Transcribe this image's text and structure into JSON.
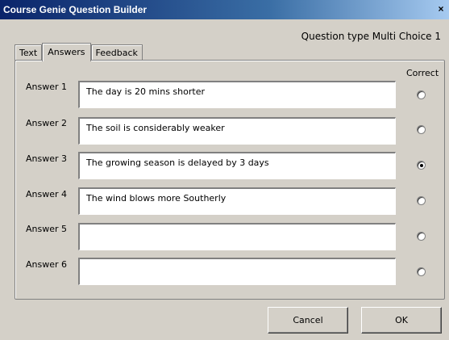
{
  "window": {
    "title": "Course Genie Question Builder",
    "close": "×"
  },
  "question_type": "Question type Multi Choice 1",
  "tabs": [
    {
      "label": "Text",
      "active": false
    },
    {
      "label": "Answers",
      "active": true
    },
    {
      "label": "Feedback",
      "active": false
    }
  ],
  "correct_label": "Correct",
  "answers": [
    {
      "label": "Answer 1",
      "value": "The day is 20 mins shorter",
      "correct": false
    },
    {
      "label": "Answer 2",
      "value": "The soil is considerably weaker",
      "correct": false
    },
    {
      "label": "Answer 3",
      "value": "The growing season is delayed by 3 days",
      "correct": true
    },
    {
      "label": "Answer 4",
      "value": "The wind blows more Southerly",
      "correct": false
    },
    {
      "label": "Answer 5",
      "value": "",
      "correct": false
    },
    {
      "label": "Answer 6",
      "value": "",
      "correct": false
    }
  ],
  "buttons": {
    "cancel": "Cancel",
    "ok": "OK"
  }
}
